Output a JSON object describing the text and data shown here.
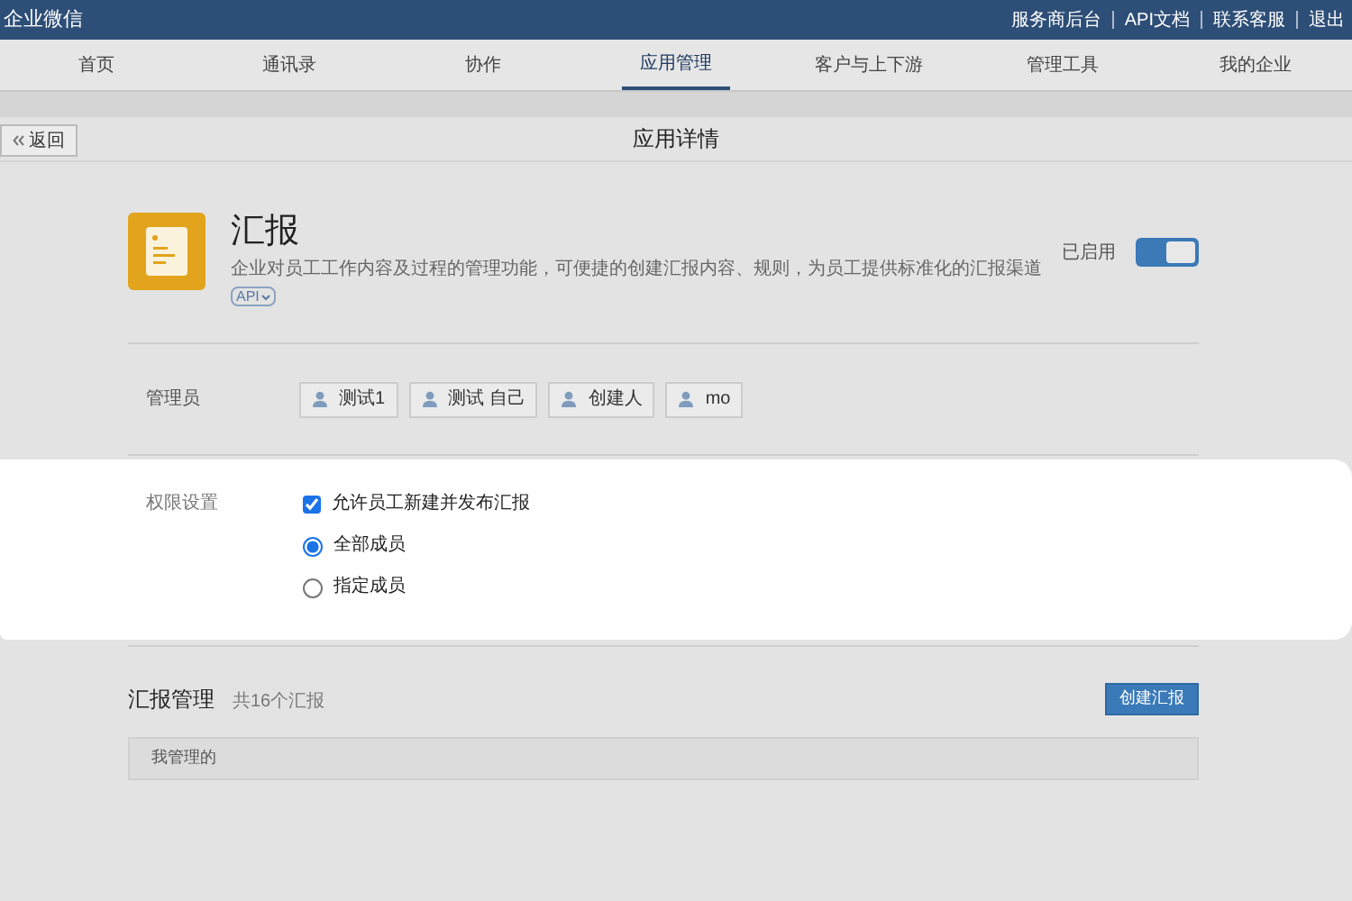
{
  "top_bar": {
    "brand": "企业微信",
    "links": [
      "服务商后台",
      "API文档",
      "联系客服",
      "退出"
    ]
  },
  "nav_tabs": [
    {
      "label": "首页",
      "selected": false
    },
    {
      "label": "通讯录",
      "selected": false
    },
    {
      "label": "协作",
      "selected": false
    },
    {
      "label": "应用管理",
      "selected": true
    },
    {
      "label": "客户与上下游",
      "selected": false
    },
    {
      "label": "管理工具",
      "selected": false
    },
    {
      "label": "我的企业",
      "selected": false
    }
  ],
  "header": {
    "back": "返回",
    "title": "应用详情"
  },
  "app": {
    "name": "汇报",
    "description": "企业对员工工作内容及过程的管理功能，可便捷的创建汇报内容、规则，为员工提供标准化的汇报渠道",
    "api_tag": "API",
    "status": "已启用",
    "enabled": true
  },
  "admins": {
    "label": "管理员",
    "people": [
      "测试1",
      "测试 自己",
      "创建人",
      "mo"
    ]
  },
  "permissions": {
    "label": "权限设置",
    "allow": {
      "label": "允许员工新建并发布汇报",
      "checked": true
    },
    "options": [
      {
        "label": "全部成员",
        "selected": true
      },
      {
        "label": "指定成员",
        "selected": false
      }
    ]
  },
  "reports": {
    "title": "汇报管理",
    "count": "共16个汇报",
    "create": "创建汇报",
    "tabs": [
      "我管理的"
    ]
  }
}
